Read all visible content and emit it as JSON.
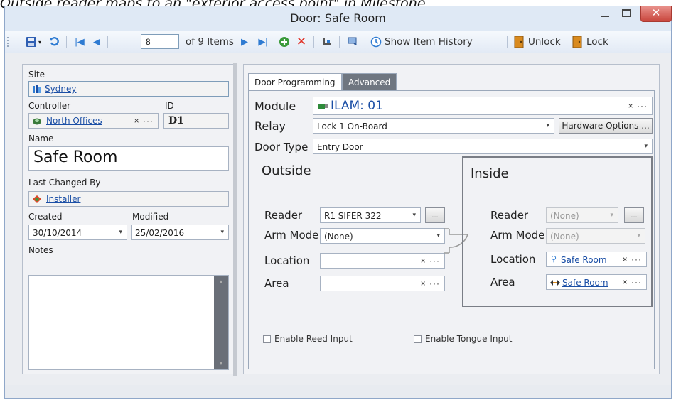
{
  "caption": "Outside reader maps to an \"exterior access point\" in Milestone.",
  "window": {
    "title": "Door: Safe Room",
    "minimize_glyph": "",
    "close_glyph": "✕"
  },
  "toolbar": {
    "page_current": "8",
    "page_of_label": "of 9 Items",
    "show_history_label": "Show Item History",
    "unlock_label": "Unlock",
    "lock_label": "Lock"
  },
  "left": {
    "site_label": "Site",
    "site_value": "Sydney",
    "controller_label": "Controller",
    "controller_value": "North Offices",
    "id_label": "ID",
    "id_value": "D1",
    "name_label": "Name",
    "name_value": "Safe Room",
    "last_changed_label": "Last Changed By",
    "last_changed_value": "Installer",
    "created_label": "Created",
    "created_value": "30/10/2014",
    "modified_label": "Modified",
    "modified_value": "25/02/2016",
    "notes_label": "Notes",
    "notes_value": ""
  },
  "tabs": [
    {
      "label": "Door Programming",
      "active": true
    },
    {
      "label": "Advanced",
      "active": false
    }
  ],
  "door": {
    "module_label": "Module",
    "module_value": "ILAM: 01",
    "relay_label": "Relay",
    "relay_value": "Lock 1 On-Board",
    "hardware_options_label": "Hardware Options ...",
    "door_type_label": "Door Type",
    "door_type_value": "Entry Door",
    "outside": {
      "title": "Outside",
      "reader_label": "Reader",
      "reader_value": "R1 SIFER 322",
      "arm_mode_label": "Arm Mode",
      "arm_mode_value": "(None)",
      "location_label": "Location",
      "location_value": "",
      "area_label": "Area",
      "area_value": ""
    },
    "inside": {
      "title": "Inside",
      "reader_label": "Reader",
      "reader_value": "(None)",
      "arm_mode_label": "Arm Mode",
      "arm_mode_value": "(None)",
      "location_label": "Location",
      "location_value": "Safe Room",
      "area_label": "Area",
      "area_value": "Safe Room"
    },
    "enable_reed_label": "Enable Reed Input",
    "enable_tongue_label": "Enable Tongue Input"
  },
  "glyphs": {
    "clear_more": "× ···",
    "dots": "...",
    "combo": "▾"
  },
  "colors": {
    "link": "#1b4fa6",
    "close_red": "#c9463d",
    "toolbar_blue": "#2e7bd2",
    "add_green": "#3a9a3a",
    "delete_red": "#e0342a",
    "lock_orange": "#d98a1e"
  }
}
